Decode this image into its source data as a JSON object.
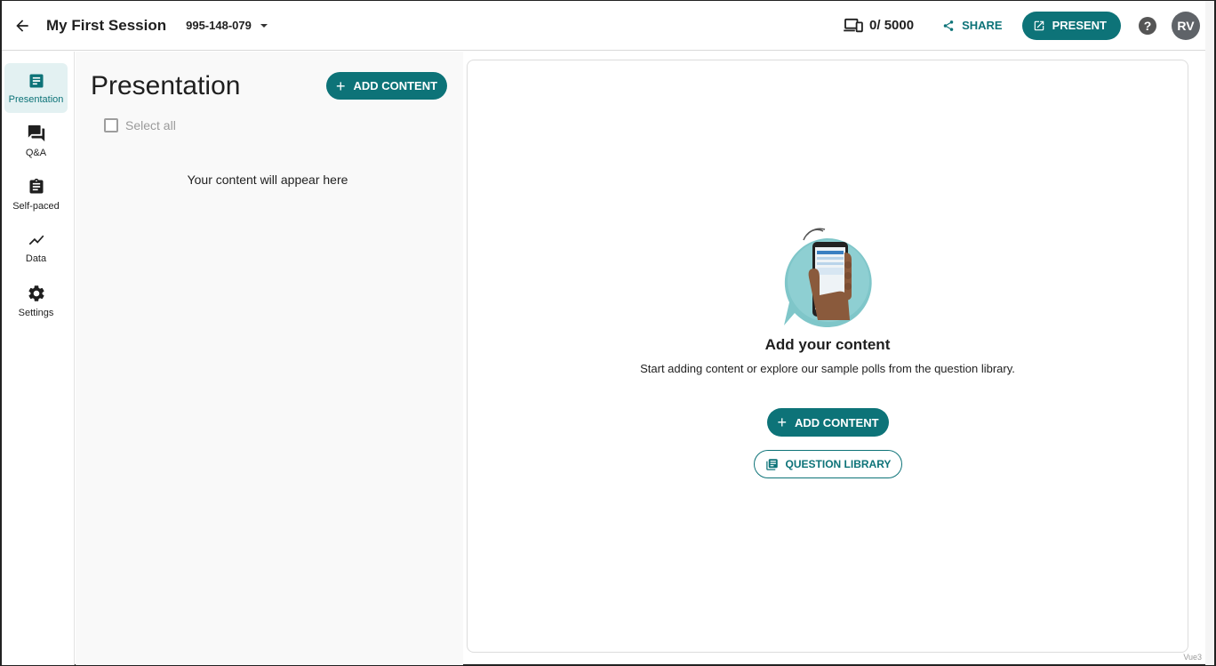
{
  "header": {
    "session_title": "My First Session",
    "session_code": "995-148-079",
    "participants": "0/ 5000",
    "share_label": "SHARE",
    "present_label": "PRESENT",
    "help_label": "?",
    "avatar_initials": "RV"
  },
  "sidebar": {
    "items": [
      {
        "label": "Presentation",
        "icon": "presentation-icon",
        "active": true
      },
      {
        "label": "Q&A",
        "icon": "forum-icon",
        "active": false
      },
      {
        "label": "Self-paced",
        "icon": "clipboard-icon",
        "active": false
      },
      {
        "label": "Data",
        "icon": "trend-line-icon",
        "active": false
      },
      {
        "label": "Settings",
        "icon": "gear-icon",
        "active": false
      }
    ]
  },
  "list_panel": {
    "title": "Presentation",
    "add_content_label": "ADD CONTENT",
    "select_all_label": "Select all",
    "empty_text": "Your content will appear here"
  },
  "main": {
    "heading": "Add your content",
    "subtext": "Start adding content or explore our sample polls from the question library.",
    "add_content_label": "ADD CONTENT",
    "question_library_label": "QUESTION LIBRARY"
  },
  "footer": {
    "tag": "Vue3"
  },
  "colors": {
    "accent": "#0d7378",
    "active_nav_bg": "#e3f1f2",
    "panel_bg": "#f9f9f9"
  }
}
